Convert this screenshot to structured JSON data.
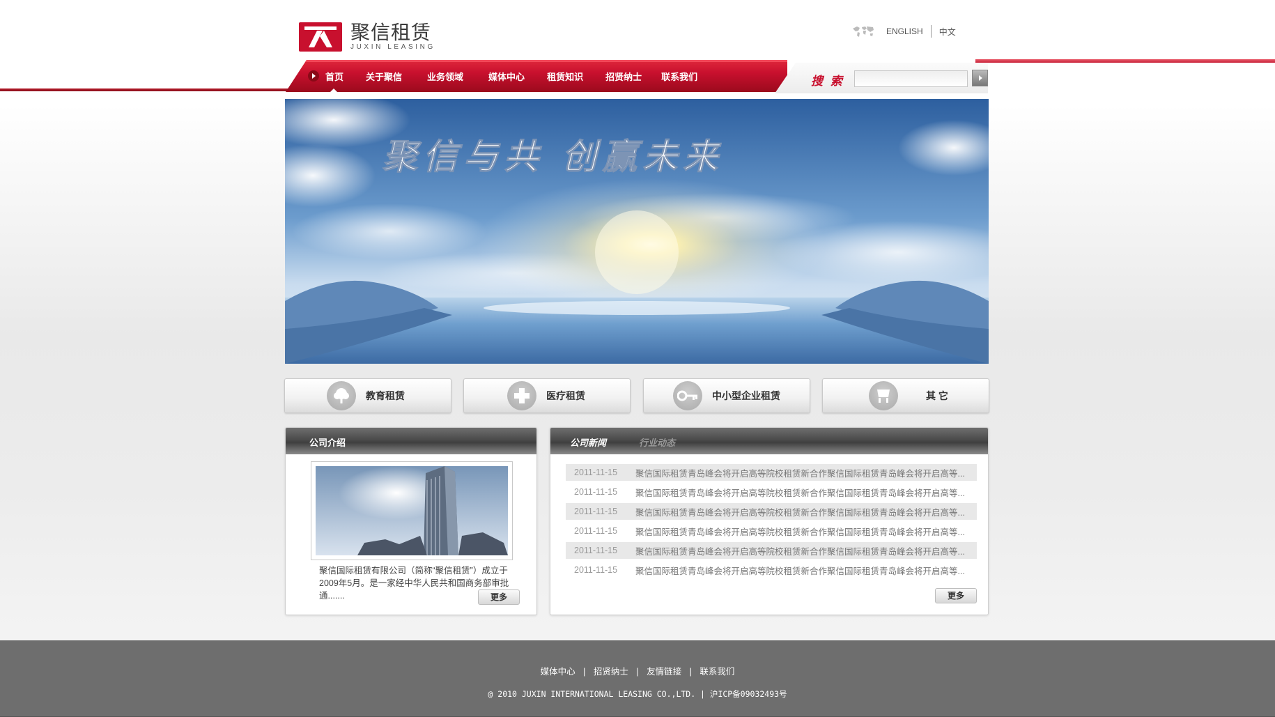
{
  "brand": {
    "name_cn": "聚信租赁",
    "name_en": "JUXIN LEASING",
    "colors": {
      "accent": "#c8102e",
      "footer": "#6e6e6e"
    }
  },
  "language": {
    "icon": "world-map-icon",
    "english": "ENGLISH",
    "chinese": "中文"
  },
  "nav": {
    "items": [
      "首页",
      "关于聚信",
      "业务领域",
      "媒体中心",
      "租赁知识",
      "招贤纳士",
      "联系我们"
    ]
  },
  "search": {
    "label": "搜 索",
    "value": "",
    "placeholder": ""
  },
  "banner": {
    "slogan": "聚信与共 创赢未来"
  },
  "categories": [
    {
      "label": "教育租赁",
      "icon": "tree-icon"
    },
    {
      "label": "医疗租赁",
      "icon": "medical-cross-icon"
    },
    {
      "label": "中小型企业租赁",
      "icon": "key-icon"
    },
    {
      "label": "其 它",
      "icon": "cart-icon"
    }
  ],
  "intro": {
    "title": "公司介绍",
    "text": "聚信国际租赁有限公司（简称“聚信租赁”）成立于2009年5月。是一家经中华人民共和国商务部审批通.......",
    "more": "更多"
  },
  "news": {
    "tabs": [
      "公司新闻",
      "行业动态"
    ],
    "items": [
      {
        "date": "2011-11-15",
        "title": "聚信国际租赁青岛峰会将开启高等院校租赁新合作聚信国际租赁青岛峰会将开启高等..."
      },
      {
        "date": "2011-11-15",
        "title": "聚信国际租赁青岛峰会将开启高等院校租赁新合作聚信国际租赁青岛峰会将开启高等..."
      },
      {
        "date": "2011-11-15",
        "title": "聚信国际租赁青岛峰会将开启高等院校租赁新合作聚信国际租赁青岛峰会将开启高等..."
      },
      {
        "date": "2011-11-15",
        "title": "聚信国际租赁青岛峰会将开启高等院校租赁新合作聚信国际租赁青岛峰会将开启高等..."
      },
      {
        "date": "2011-11-15",
        "title": "聚信国际租赁青岛峰会将开启高等院校租赁新合作聚信国际租赁青岛峰会将开启高等..."
      },
      {
        "date": "2011-11-15",
        "title": "聚信国际租赁青岛峰会将开启高等院校租赁新合作聚信国际租赁青岛峰会将开启高等..."
      }
    ],
    "more": "更多"
  },
  "footer": {
    "links": [
      "媒体中心",
      "招贤纳士",
      "友情链接",
      "联系我们"
    ],
    "separator": "|",
    "copyright": "@ 2010 JUXIN INTERNATIONAL LEASING CO.,LTD.  | 沪ICP备09032493号"
  }
}
